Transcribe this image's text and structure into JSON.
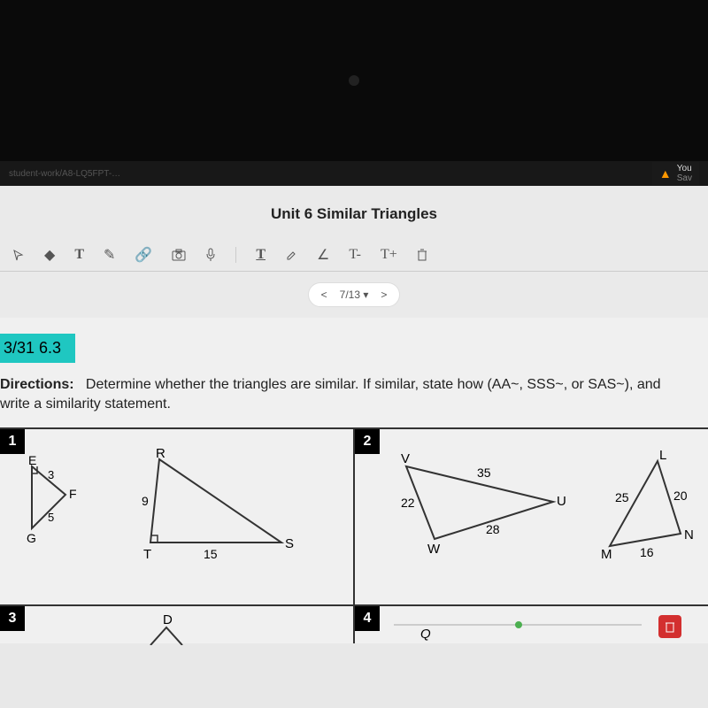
{
  "url_snippet": "student-work/A8-LQ5FPT-…",
  "warning": {
    "line1": "You",
    "line2": "Sav"
  },
  "doc_title": "Unit 6 Similar Triangles",
  "toolbar": {
    "t1": "T",
    "underline_t": "T",
    "angle": "∠",
    "t_minus": "T-",
    "t_plus": "T+"
  },
  "pager": {
    "prev": "<",
    "label": "7/13 ▾",
    "next": ">"
  },
  "section": "3/31   6.3",
  "directions_label": "Directions:",
  "directions_text": "Determine whether the triangles are similar.  If similar, state how (AA~, SSS~, or SAS~), and write a similarity statement.",
  "p1": {
    "num": "1",
    "tri_a": {
      "E": "E",
      "F": "F",
      "G": "G",
      "s1": "3",
      "s2": "5"
    },
    "tri_b": {
      "R": "R",
      "S": "S",
      "T": "T",
      "s1": "9",
      "s2": "15"
    }
  },
  "p2": {
    "num": "2",
    "tri_a": {
      "V": "V",
      "U": "U",
      "W": "W",
      "s1": "22",
      "s2": "35",
      "s3": "28"
    },
    "tri_b": {
      "L": "L",
      "M": "M",
      "N": "N",
      "s1": "25",
      "s2": "20",
      "s3": "16"
    }
  },
  "p3": {
    "num": "3",
    "D": "D"
  },
  "p4": {
    "num": "4",
    "Q": "Q"
  }
}
